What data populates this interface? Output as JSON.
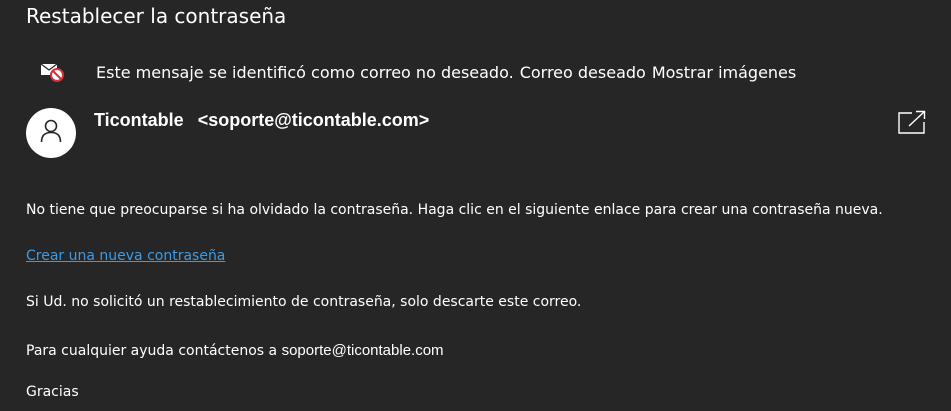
{
  "message": {
    "subject": "Restablecer la contraseña"
  },
  "junk_bar": {
    "icon": "blocked-mail-icon",
    "notice": "Este mensaje se identificó como correo no deseado.",
    "junk_link": "Correo deseado",
    "images_link": "Mostrar imágenes"
  },
  "sender": {
    "avatar_icon": "person-icon",
    "name": "Ticontable",
    "email": "<soporte@ticontable.com>"
  },
  "toolbar": {
    "popout_icon": "open-in-new-window-icon"
  },
  "body": {
    "intro": "No tiene que preocuparse si ha olvidado la contraseña. Haga clic en el siguiente enlace para crear una contraseña nueva.",
    "reset_link": "Crear una nueva contraseña",
    "ignore_note": "Si Ud. no solicitó un restablecimiento de contraseña, solo descarte este correo.",
    "help_prefix": "Para cualquier ayuda contáctenos a",
    "help_email": "soporte@ticontable.com",
    "closing": "Gracias"
  },
  "colors": {
    "background": "#262626",
    "text": "#ffffff",
    "link": "#3b9be8",
    "block_badge": "#d13438"
  }
}
